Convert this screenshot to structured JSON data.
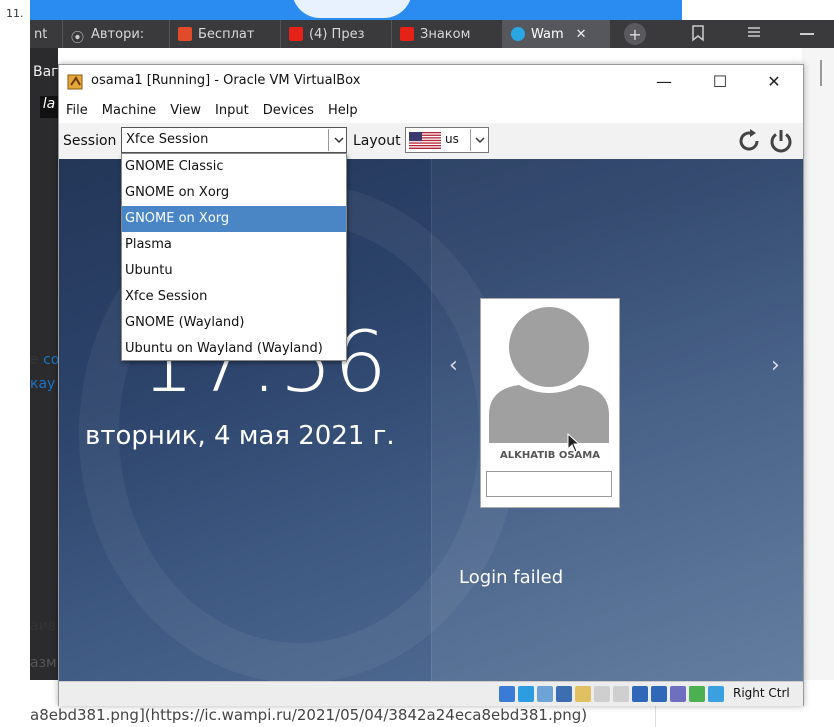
{
  "list_number": "11.",
  "browser": {
    "tabs": [
      {
        "label": "nt",
        "color": "#6a6a6a"
      },
      {
        "label": "Автори:",
        "color": "#999999"
      },
      {
        "label": "Бесплат",
        "color": "#e24a2c"
      },
      {
        "label": "(4) През",
        "color": "#e62117"
      },
      {
        "label": "Знаком",
        "color": "#e62117"
      },
      {
        "label": "Wam",
        "color": "#29a7e4"
      }
    ],
    "close_glyph": "✕",
    "new_tab_glyph": "+"
  },
  "page_left": {
    "text1": "Ваг",
    "text2": "la"
  },
  "side_texts": {
    "line1_prefix": "е",
    "line1_link": "со",
    "line2": "кау",
    "line3": "аив",
    "line4": "азм"
  },
  "url_text": "a8ebd381.png](https://ic.wampi.ru/2021/05/04/3842a24eca8ebd381.png)",
  "vbox": {
    "title": "osama1 [Running] - Oracle VM VirtualBox",
    "win_controls": {
      "minimize": "—",
      "maximize": "☐",
      "close": "✕"
    },
    "menu": [
      "File",
      "Machine",
      "View",
      "Input",
      "Devices",
      "Help"
    ],
    "host_key": "Right Ctrl",
    "status_icons": [
      "#3a7bd5",
      "#2b9de0",
      "#6ea3d8",
      "#3d6fb0",
      "#e0c060",
      "#cfcfcf",
      "#cfcfcf",
      "#2f68b8",
      "#2f68b8",
      "#6f6fc0",
      "#4caf50",
      "#3aa0e0"
    ]
  },
  "guest": {
    "session_label": "Session",
    "session_value": "Xfce Session",
    "layout_label": "Layout",
    "layout_value": "us",
    "session_options": [
      "GNOME Classic",
      "GNOME on Xorg",
      "GNOME on Xorg",
      "Plasma",
      "Ubuntu",
      "Xfce Session",
      "GNOME (Wayland)",
      "Ubuntu on Wayland (Wayland)"
    ],
    "highlighted_index": 2,
    "clock": "17:56",
    "date": "вторник, 4 мая 2021 г.",
    "user_name": "ALKHATIB OSAMA",
    "login_status": "Login failed",
    "prev_glyph": "‹",
    "next_glyph": "›"
  }
}
